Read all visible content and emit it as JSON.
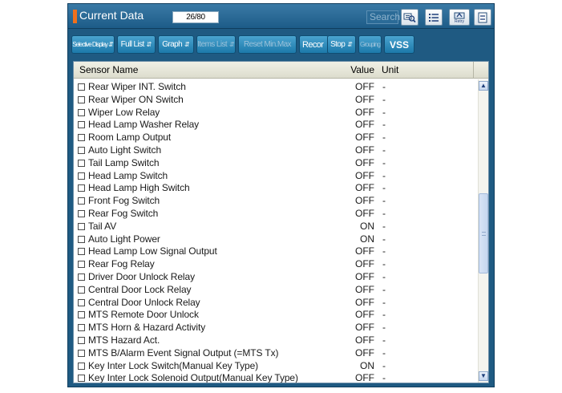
{
  "colors": {
    "frame": "#1f5a82",
    "button": "#2a8abd",
    "accent": "#f0701c"
  },
  "titlebar": {
    "title": "Current Data",
    "counter": "26/80",
    "search_placeholder": "Search",
    "icons": [
      "zoom-icon",
      "list-icon",
      "retry-icon",
      "menu-icon"
    ],
    "retry_label": "Retry"
  },
  "toolbar": {
    "selective_display": "Selective Display",
    "full_list": "Full List",
    "graph": "Graph",
    "items_list": "Items List",
    "reset_minmax": "Reset Min.Max",
    "record": "Recor",
    "stop": "Stop",
    "grouping": "Grouping",
    "vss": "VSS"
  },
  "table": {
    "headers": {
      "name": "Sensor Name",
      "value": "Value",
      "unit": "Unit"
    },
    "rows": [
      {
        "name": "Rear Wiper INT. Switch",
        "value": "OFF",
        "unit": "-"
      },
      {
        "name": "Rear Wiper ON Switch",
        "value": "OFF",
        "unit": "-"
      },
      {
        "name": "Wiper Low Relay",
        "value": "OFF",
        "unit": "-"
      },
      {
        "name": "Head Lamp Washer Relay",
        "value": "OFF",
        "unit": "-"
      },
      {
        "name": "Room Lamp Output",
        "value": "OFF",
        "unit": "-"
      },
      {
        "name": "Auto Light Switch",
        "value": "OFF",
        "unit": "-"
      },
      {
        "name": "Tail Lamp Switch",
        "value": "OFF",
        "unit": "-"
      },
      {
        "name": "Head Lamp Switch",
        "value": "OFF",
        "unit": "-"
      },
      {
        "name": "Head Lamp High Switch",
        "value": "OFF",
        "unit": "-"
      },
      {
        "name": "Front Fog Switch",
        "value": "OFF",
        "unit": "-"
      },
      {
        "name": "Rear Fog Switch",
        "value": "OFF",
        "unit": "-"
      },
      {
        "name": "Tail AV",
        "value": "ON",
        "unit": "-"
      },
      {
        "name": "Auto Light Power",
        "value": "ON",
        "unit": "-"
      },
      {
        "name": "Head Lamp Low Signal Output",
        "value": "OFF",
        "unit": "-"
      },
      {
        "name": "Rear Fog Relay",
        "value": "OFF",
        "unit": "-"
      },
      {
        "name": "Driver Door Unlock Relay",
        "value": "OFF",
        "unit": "-"
      },
      {
        "name": "Central Door Lock Relay",
        "value": "OFF",
        "unit": "-"
      },
      {
        "name": "Central Door Unlock Relay",
        "value": "OFF",
        "unit": "-"
      },
      {
        "name": "MTS Remote Door Unlock",
        "value": "OFF",
        "unit": "-"
      },
      {
        "name": "MTS Horn & Hazard Activity",
        "value": "OFF",
        "unit": "-"
      },
      {
        "name": "MTS Hazard Act.",
        "value": "OFF",
        "unit": "-"
      },
      {
        "name": "MTS B/Alarm Event Signal Output (=MTS Tx)",
        "value": "OFF",
        "unit": "-"
      },
      {
        "name": "Key Inter Lock Switch(Manual Key Type)",
        "value": "ON",
        "unit": "-"
      },
      {
        "name": "Key Inter Lock Solenoid Output(Manual Key Type)",
        "value": "OFF",
        "unit": "-"
      }
    ]
  }
}
